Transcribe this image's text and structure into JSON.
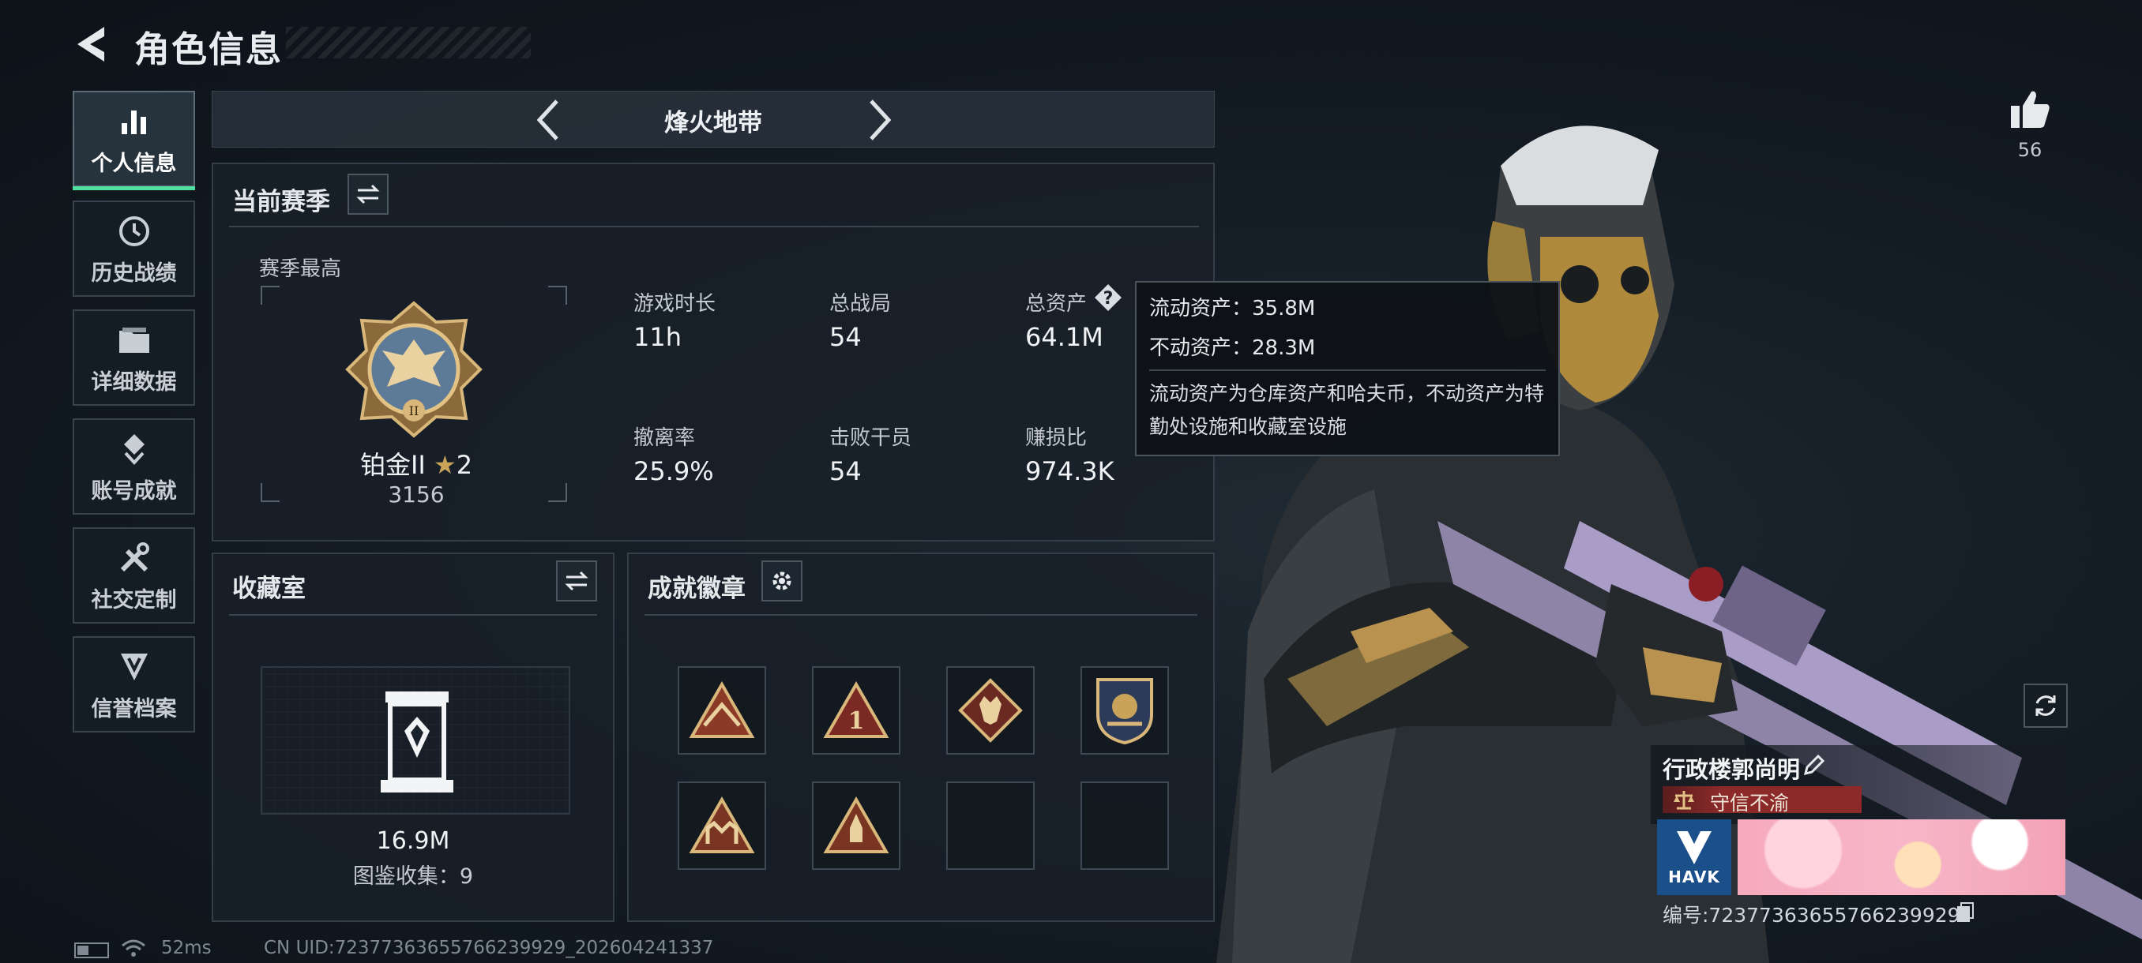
{
  "header": {
    "title": "角色信息"
  },
  "sidebar": {
    "items": [
      {
        "label": "个人信息",
        "icon": "bar-chart-icon",
        "active": true
      },
      {
        "label": "历史战绩",
        "icon": "history-icon",
        "active": false
      },
      {
        "label": "详细数据",
        "icon": "folder-icon",
        "active": false
      },
      {
        "label": "账号成就",
        "icon": "achievement-icon",
        "active": false
      },
      {
        "label": "社交定制",
        "icon": "tools-icon",
        "active": false
      },
      {
        "label": "信誉档案",
        "icon": "shield-icon",
        "active": false
      }
    ]
  },
  "mode": {
    "name": "烽火地带"
  },
  "season": {
    "title": "当前赛季",
    "best_label": "赛季最高",
    "rank_name": "铂金II",
    "rank_stars": "2",
    "rank_score": "3156",
    "stats": [
      {
        "label": "游戏时长",
        "value": "11h"
      },
      {
        "label": "总战局",
        "value": "54"
      },
      {
        "label": "总资产",
        "value": "64.1M"
      },
      {
        "label": "撤离率",
        "value": "25.9%"
      },
      {
        "label": "击败干员",
        "value": "54"
      },
      {
        "label": "赚损比",
        "value": "974.3K"
      }
    ]
  },
  "tooltip": {
    "liquid": "流动资产：35.8M",
    "fixed": "不动资产：28.3M",
    "description": "流动资产为仓库资产和哈夫币，不动资产为特勤处设施和收藏室设施"
  },
  "collection": {
    "title": "收藏室",
    "value": "16.9M",
    "count": "图鉴收集：9"
  },
  "achievements": {
    "title": "成就徽章",
    "slots": [
      "badge-mountain-icon",
      "badge-number-one-icon",
      "badge-wolf-icon",
      "badge-crest-icon",
      "badge-fortress-icon",
      "badge-rocket-icon",
      "empty",
      "empty"
    ]
  },
  "like": {
    "count": "56"
  },
  "player": {
    "name": "行政楼郭尚明",
    "motto": "守信不渝",
    "logo_text": "HAVK",
    "id": "编号:72377363655766239929"
  },
  "status": {
    "ping": "52ms",
    "uid": "CN UID:72377363655766239929_202604241337"
  },
  "colors": {
    "accent_green": "#4fe0a0",
    "panel_border": "#333e48",
    "motto_red": "#8c2a2a"
  }
}
